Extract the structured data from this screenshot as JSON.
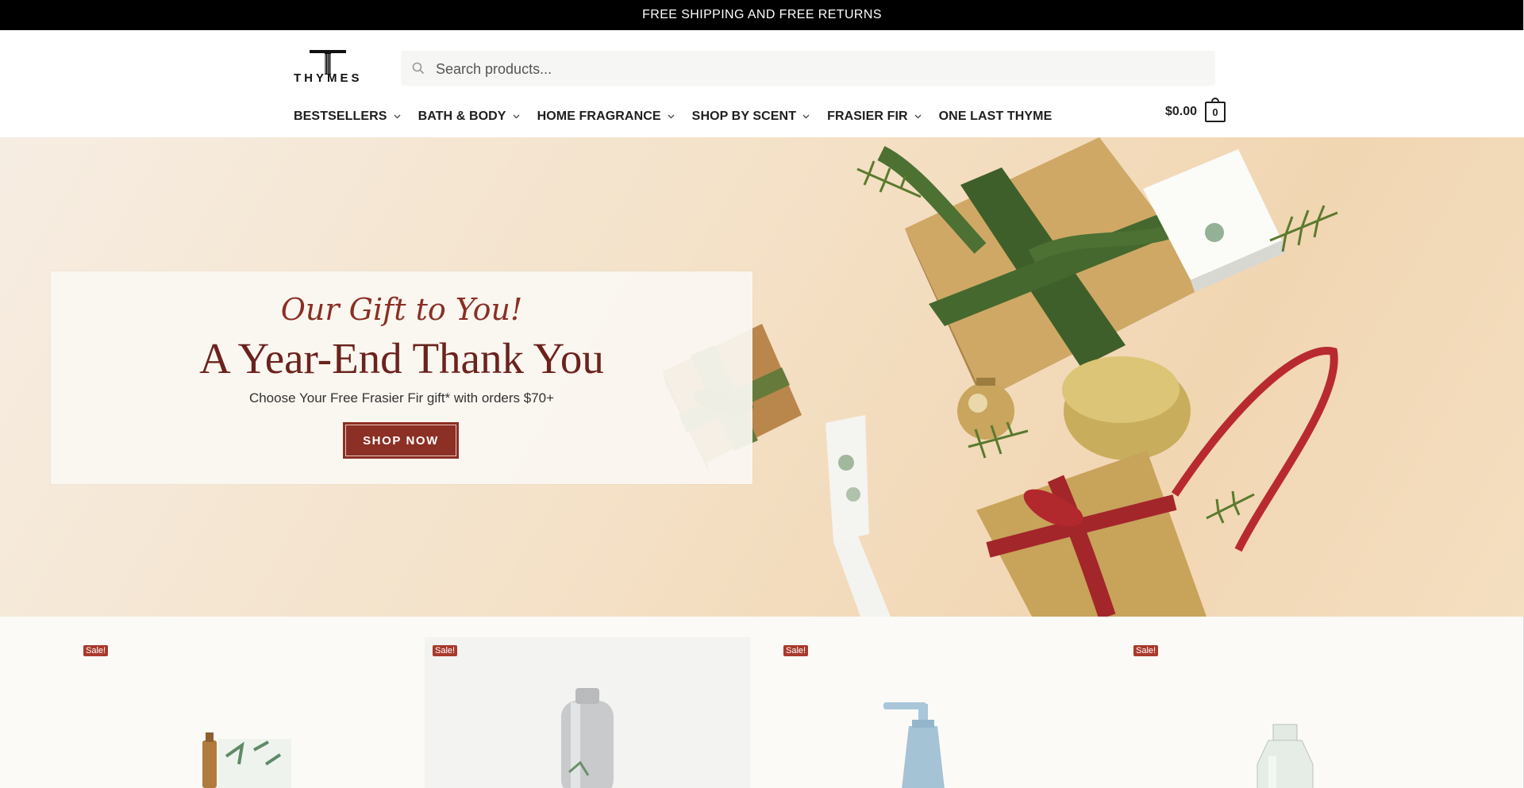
{
  "announcement": "FREE SHIPPING AND FREE RETURNS",
  "brand": {
    "name": "THYMES"
  },
  "search": {
    "placeholder": "Search products..."
  },
  "nav": {
    "items": [
      {
        "label": "BESTSELLERS",
        "has_dropdown": true
      },
      {
        "label": "BATH & BODY",
        "has_dropdown": true
      },
      {
        "label": "HOME FRAGRANCE",
        "has_dropdown": true
      },
      {
        "label": "SHOP BY SCENT",
        "has_dropdown": true
      },
      {
        "label": "FRASIER FIR",
        "has_dropdown": true
      },
      {
        "label": "ONE LAST THYME",
        "has_dropdown": false
      }
    ]
  },
  "cart": {
    "total": "$0.00",
    "count": "0"
  },
  "hero": {
    "subtitle": "Our Gift to You!",
    "title": "A Year-End Thank You",
    "text": "Choose Your Free Frasier Fir gift* with orders $70+",
    "button": "SHOP NOW"
  },
  "products": [
    {
      "badge": "Sale!"
    },
    {
      "badge": "Sale!"
    },
    {
      "badge": "Sale!"
    },
    {
      "badge": "Sale!"
    }
  ],
  "colors": {
    "accent": "#8c2f25",
    "topbar": "#000000",
    "hero_background": "#f4e1c7"
  },
  "icons": {
    "search": "search-icon",
    "chevron": "chevron-down-icon",
    "cart": "cart-bag-icon"
  }
}
